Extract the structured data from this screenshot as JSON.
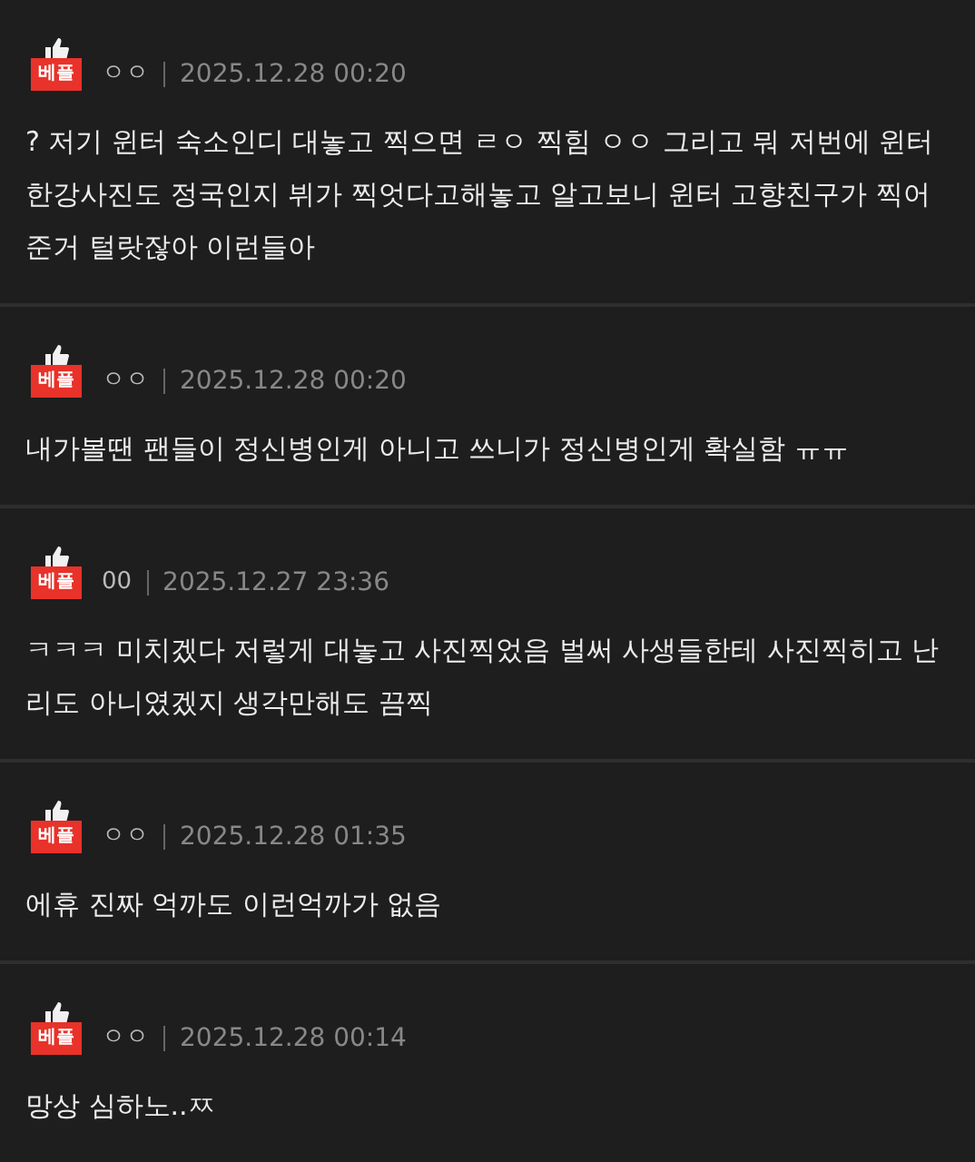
{
  "comments": [
    {
      "badge": "베플",
      "author": "ㅇㅇ",
      "date": "2025.12.28 00:20",
      "text": "? 저기 윈터 숙소인디 대놓고 찍으면 ㄹㅇ 찍힘 ㅇㅇ 그리고 뭐 저번에 윈터 한강사진도 정국인지 뷔가 찍엇다고해놓고 알고보니 윈터 고향친구가 찍어준거 털랏잖아 이런들아"
    },
    {
      "badge": "베플",
      "author": "ㅇㅇ",
      "date": "2025.12.28 00:20",
      "text": "내가볼땐 팬들이 정신병인게 아니고 쓰니가 정신병인게 확실함 ㅠㅠ"
    },
    {
      "badge": "베플",
      "author": "00",
      "date": "2025.12.27 23:36",
      "text": "ㅋㅋㅋ 미치겠다 저렇게 대놓고 사진찍었음 벌써 사생들한테 사진찍히고 난리도 아니였겠지 생각만해도 끔찍"
    },
    {
      "badge": "베플",
      "author": "ㅇㅇ",
      "date": "2025.12.28 01:35",
      "text": "에휴 진짜 억까도 이런억까가 없음"
    },
    {
      "badge": "베플",
      "author": "ㅇㅇ",
      "date": "2025.12.28 00:14",
      "text": "망상 심하노..ㅉ"
    }
  ]
}
